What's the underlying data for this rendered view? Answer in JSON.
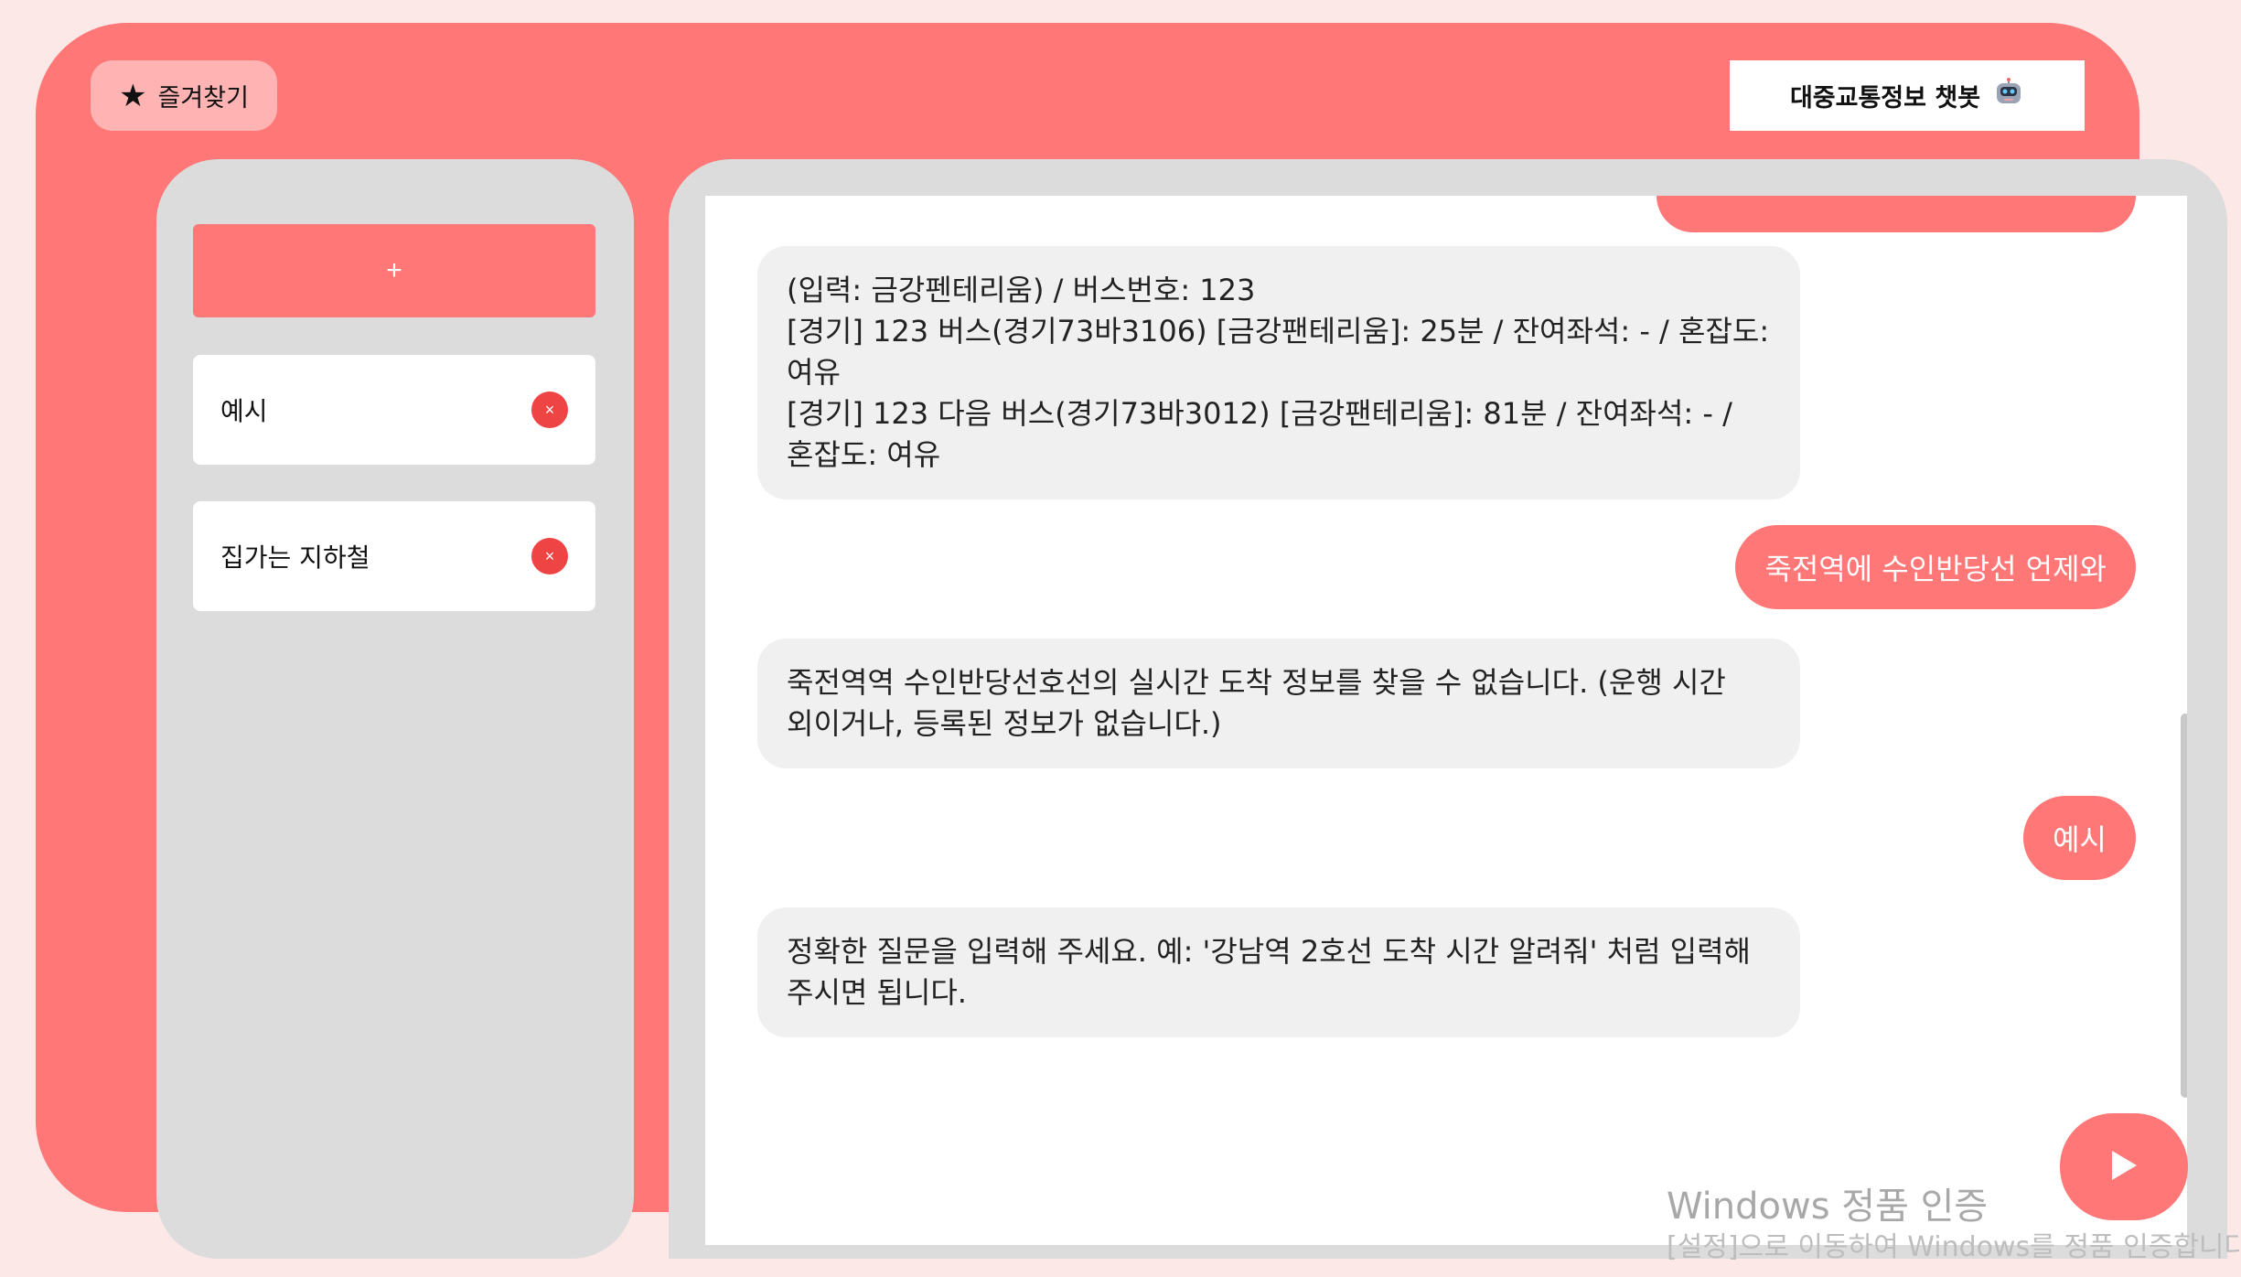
{
  "header": {
    "favorites_label": "즐겨찾기",
    "favorites_icon": "star-icon",
    "title": "대중교통정보 챗봇",
    "title_icon": "robot-icon"
  },
  "sidebar": {
    "new_chat_label": "+",
    "items": [
      {
        "label": "예시",
        "delete_label": "×"
      },
      {
        "label": "집가는 지하철",
        "delete_label": "×"
      }
    ]
  },
  "chat": {
    "messages": [
      {
        "role": "bot",
        "text": "(입력: 금강펜테리움) / 버스번호: 123\n[경기] 123 버스(경기73바3106) [금강팬테리움]: 25분 / 잔여좌석: - / 혼잡도: 여유\n[경기] 123 다음 버스(경기73바3012) [금강팬테리움]: 81분 / 잔여좌석: - / 혼잡도: 여유"
      },
      {
        "role": "user",
        "text": "죽전역에 수인반당선 언제와"
      },
      {
        "role": "bot",
        "text": "죽전역역 수인반당선호선의 실시간 도착 정보를 찾을 수 없습니다. (운행 시간 외이거나, 등록된 정보가 없습니다.)"
      },
      {
        "role": "user",
        "text": "예시"
      },
      {
        "role": "bot",
        "text": "정확한 질문을 입력해 주세요. 예: '강남역 2호선 도착 시간 알려줘' 처럼 입력해 주시면 됩니다."
      }
    ]
  },
  "input": {
    "value": "",
    "placeholder": "",
    "send_icon": "play-icon"
  },
  "watermark": {
    "title": "Windows 정품 인증",
    "subtitle": "[설정]으로 이동하여 Windows를 정품 인증합니다."
  },
  "colors": {
    "accent": "#ff7777",
    "panel": "#dcdcdc",
    "bot_bubble": "#f0f0f0",
    "delete": "#ef4444",
    "favorites_bg": "#ffb3b3"
  }
}
